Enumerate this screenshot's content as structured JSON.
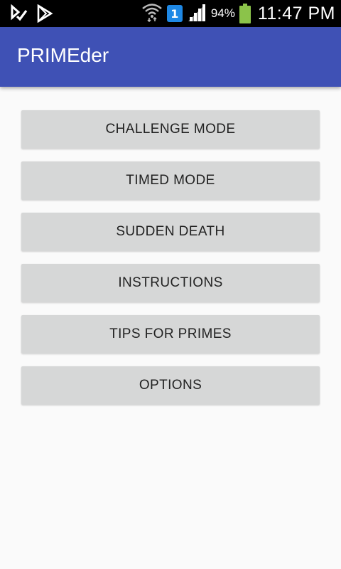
{
  "status_bar": {
    "battery_percent": "94%",
    "time": "11:47 PM",
    "sim_label": "1",
    "icons": [
      "notification-check-icon",
      "play-store-icon",
      "wifi-icon",
      "sim-icon",
      "signal-icon",
      "battery-icon"
    ],
    "battery_color": "#8bc34a"
  },
  "app_bar": {
    "title": "PRIMEder",
    "color": "#3f51b5"
  },
  "menu": {
    "buttons": [
      {
        "label": "CHALLENGE MODE"
      },
      {
        "label": "TIMED MODE"
      },
      {
        "label": "SUDDEN DEATH"
      },
      {
        "label": "INSTRUCTIONS"
      },
      {
        "label": "TIPS FOR PRIMES"
      },
      {
        "label": "OPTIONS"
      }
    ]
  }
}
